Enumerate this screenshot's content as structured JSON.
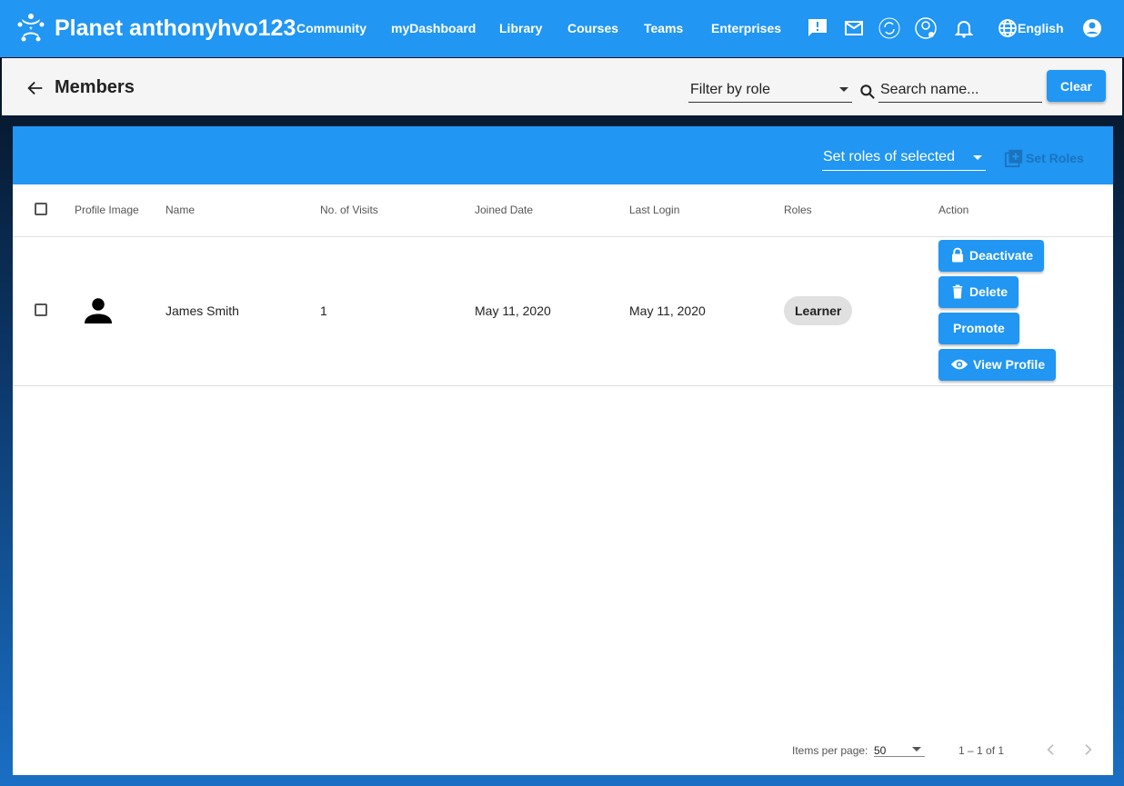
{
  "app": {
    "title": "Planet anthonyhvo123",
    "nav": [
      "Community",
      "myDashboard",
      "Library",
      "Courses",
      "Teams",
      "Enterprises"
    ],
    "language": "English"
  },
  "page": {
    "title": "Members",
    "filter_placeholder": "Filter by role",
    "search_placeholder": "Search name...",
    "clear_label": "Clear"
  },
  "bulk": {
    "set_roles_select": "Set roles of selected",
    "set_roles_button": "Set Roles"
  },
  "table": {
    "headers": [
      "Profile Image",
      "Name",
      "No. of Visits",
      "Joined Date",
      "Last Login",
      "Roles",
      "Action"
    ],
    "rows": [
      {
        "name": "James Smith",
        "visits": "1",
        "joined": "May 11, 2020",
        "last_login": "May 11, 2020",
        "role": "Learner",
        "actions": [
          "Deactivate",
          "Delete",
          "Promote",
          "View Profile"
        ]
      }
    ]
  },
  "paginator": {
    "items_per_page_label": "Items per page:",
    "items_per_page": "50",
    "range": "1 – 1 of 1"
  },
  "colors": {
    "primary": "#2196f3"
  }
}
